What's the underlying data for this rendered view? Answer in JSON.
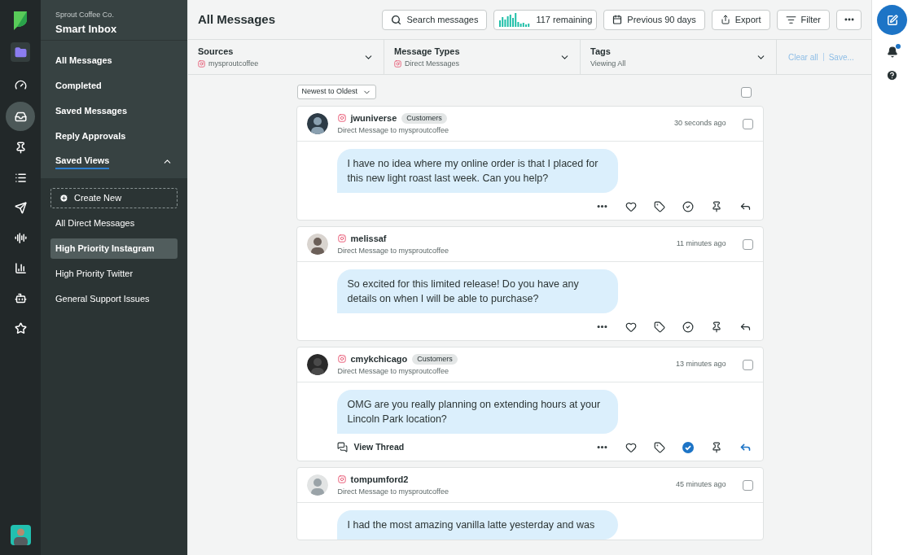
{
  "brand": {
    "company": "Sprout Coffee Co.",
    "title": "Smart Inbox"
  },
  "rail": [
    {
      "kind": "folder",
      "selected": false
    },
    {
      "kind": "gauge",
      "selected": false
    },
    {
      "kind": "inbox",
      "selected": true
    },
    {
      "kind": "pin",
      "selected": false
    },
    {
      "kind": "list",
      "selected": false
    },
    {
      "kind": "send",
      "selected": false
    },
    {
      "kind": "wave",
      "selected": false
    },
    {
      "kind": "bars",
      "selected": false
    },
    {
      "kind": "robot",
      "selected": false
    },
    {
      "kind": "star",
      "selected": false
    }
  ],
  "nav": [
    {
      "label": "All Messages"
    },
    {
      "label": "Completed"
    },
    {
      "label": "Saved Messages"
    },
    {
      "label": "Reply Approvals"
    }
  ],
  "saved_views": {
    "label": "Saved Views",
    "expanded": true,
    "create": "Create New",
    "items": [
      {
        "label": "All Direct Messages",
        "selected": false
      },
      {
        "label": "High Priority Instagram",
        "selected": true
      },
      {
        "label": "High Priority Twitter",
        "selected": false
      },
      {
        "label": "General Support Issues",
        "selected": false
      }
    ]
  },
  "header": {
    "title": "All Messages",
    "search": "Search messages",
    "remaining": "117 remaining",
    "period": "Previous 90 days",
    "export": "Export",
    "filter": "Filter"
  },
  "filters": [
    {
      "label": "Sources",
      "value": "mysproutcoffee",
      "instagram": true
    },
    {
      "label": "Message Types",
      "value": "Direct Messages",
      "instagram": true
    },
    {
      "label": "Tags",
      "value": "Viewing All",
      "instagram": false
    }
  ],
  "filter_actions": [
    "Clear all",
    "Save..."
  ],
  "sort": "Newest to Oldest",
  "select_all": {
    "checked": false
  },
  "messages": [
    {
      "user": "jwuniverse",
      "tag": "Customers",
      "subtitle": "Direct Message to mysproutcoffee",
      "time": "30 seconds ago",
      "checked": false,
      "text": "I have no idea where my online order is that I placed for this new light roast last week. Can you help?",
      "completed": false,
      "replied": false
    },
    {
      "user": "melissaf",
      "subtitle": "Direct Message to mysproutcoffee",
      "time": "11 minutes ago",
      "checked": false,
      "text": "So excited for this limited release! Do you have any details on when I will be able to purchase?",
      "completed": false,
      "replied": false
    },
    {
      "user": "cmykchicago",
      "tag": "Customers",
      "subtitle": "Direct Message to mysproutcoffee",
      "time": "13 minutes ago",
      "checked": false,
      "text": "OMG are you really planning on extending hours at your Lincoln Park location?",
      "thread": "View Thread",
      "completed": true,
      "replied": true
    },
    {
      "user": "tompumford2",
      "subtitle": "Direct Message to mysproutcoffee",
      "time": "45 minutes ago",
      "checked": false,
      "text": "I had the most amazing vanilla latte yesterday and was"
    }
  ],
  "notifications": {
    "unread": true
  }
}
